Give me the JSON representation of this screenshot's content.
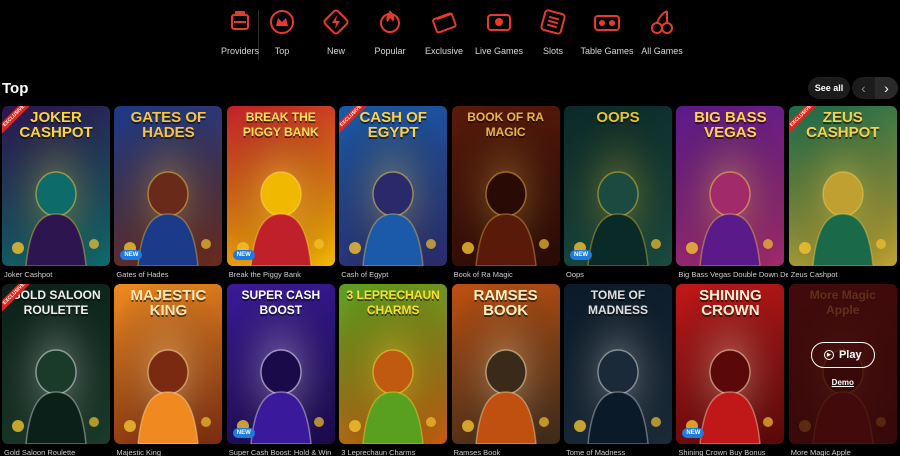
{
  "nav": {
    "categories": [
      {
        "label": "Providers",
        "icon": "providers-icon"
      },
      {
        "label": "Top",
        "icon": "crown-icon"
      },
      {
        "label": "New",
        "icon": "new-icon"
      },
      {
        "label": "Popular",
        "icon": "popular-icon"
      },
      {
        "label": "Exclusive",
        "icon": "exclusive-icon"
      },
      {
        "label": "Live Games",
        "icon": "live-games-icon"
      },
      {
        "label": "Slots",
        "icon": "slots-icon"
      },
      {
        "label": "Table Games",
        "icon": "table-games-icon"
      },
      {
        "label": "All Games",
        "icon": "cherries-icon"
      }
    ],
    "accent": "#e8392c"
  },
  "section": {
    "title": "Top",
    "see_all": "See all",
    "prev_icon": "chevron-left-icon",
    "next_icon": "chevron-right-icon"
  },
  "badges": {
    "new": "NEW",
    "exclusive": "EXCLUSIVE"
  },
  "games": [
    {
      "name": "Joker Cashpot",
      "art_title": "JOKER CASHPOT",
      "exclusive": true,
      "new": false,
      "colors": [
        "#2d1550",
        "#0d6b6a"
      ],
      "title_color": "#f9d43a"
    },
    {
      "name": "Gates of Hades",
      "art_title": "GATES OF HADES",
      "exclusive": false,
      "new": true,
      "colors": [
        "#1b3a8a",
        "#6a2a1a"
      ],
      "title_color": "#f4c542"
    },
    {
      "name": "Break the Piggy Bank",
      "art_title": "BREAK THE PIGGY BANK",
      "exclusive": false,
      "new": true,
      "colors": [
        "#c0202a",
        "#f0b800"
      ],
      "title_color": "#ffe15a"
    },
    {
      "name": "Cash of Egypt",
      "art_title": "CASH OF EGYPT",
      "exclusive": true,
      "new": false,
      "colors": [
        "#1a5aa8",
        "#2a2a6a"
      ],
      "title_color": "#f7d24a"
    },
    {
      "name": "Book of Ra Magic",
      "art_title": "BOOK OF RA MAGIC",
      "exclusive": false,
      "new": false,
      "colors": [
        "#5a1a0a",
        "#2a0a05"
      ],
      "title_color": "#e8b84a"
    },
    {
      "name": "Oops",
      "art_title": "OOPS",
      "exclusive": false,
      "new": true,
      "colors": [
        "#0a2a28",
        "#1a4a40"
      ],
      "title_color": "#e8c430"
    },
    {
      "name": "Big Bass Vegas Double Down Deluxe",
      "art_title": "BIG BASS VEGAS",
      "exclusive": false,
      "new": false,
      "colors": [
        "#5a1a8a",
        "#a02a6a"
      ],
      "title_color": "#ffd24a"
    },
    {
      "name": "Zeus Cashpot",
      "art_title": "ZEUS CASHPOT",
      "exclusive": true,
      "new": false,
      "colors": [
        "#1a6a4a",
        "#c0a030"
      ],
      "title_color": "#f2d050"
    },
    {
      "name": "Gold Saloon Roulette",
      "art_title": "GOLD SALOON ROULETTE",
      "exclusive": true,
      "new": false,
      "colors": [
        "#0a2018",
        "#1a3a2a"
      ],
      "title_color": "#f0f0f0"
    },
    {
      "name": "Majestic King",
      "art_title": "MAJESTIC KING",
      "exclusive": false,
      "new": false,
      "colors": [
        "#f08a20",
        "#7a2a10"
      ],
      "title_color": "#ffe8b0"
    },
    {
      "name": "Super Cash Boost: Hold & Win",
      "art_title": "SUPER CASH BOOST",
      "exclusive": false,
      "new": true,
      "colors": [
        "#3a1a9a",
        "#1a0a4a"
      ],
      "title_color": "#ffffff"
    },
    {
      "name": "3 Leprechaun Charms",
      "art_title": "3 LEPRECHAUN CHARMS",
      "exclusive": false,
      "new": false,
      "colors": [
        "#5aa020",
        "#c05a10"
      ],
      "title_color": "#f8e030"
    },
    {
      "name": "Ramses Book",
      "art_title": "RAMSES BOOK",
      "exclusive": false,
      "new": false,
      "colors": [
        "#c05010",
        "#3a2a1a"
      ],
      "title_color": "#fff0c0"
    },
    {
      "name": "Tome of Madness",
      "art_title": "TOME OF MADNESS",
      "exclusive": false,
      "new": false,
      "colors": [
        "#0a1a28",
        "#1a2a38"
      ],
      "title_color": "#e0e0e0"
    },
    {
      "name": "Shining Crown Buy Bonus",
      "art_title": "SHINING CROWN",
      "exclusive": false,
      "new": true,
      "colors": [
        "#c01818",
        "#5a0808"
      ],
      "title_color": "#fff0d0"
    },
    {
      "name": "More Magic Apple",
      "art_title": "More Magic Apple",
      "exclusive": false,
      "new": false,
      "colors": [
        "#5a0a10",
        "#2a0508"
      ],
      "title_color": "#e8b050",
      "hover": true
    }
  ],
  "overlay": {
    "play": "Play",
    "demo": "Demo"
  }
}
